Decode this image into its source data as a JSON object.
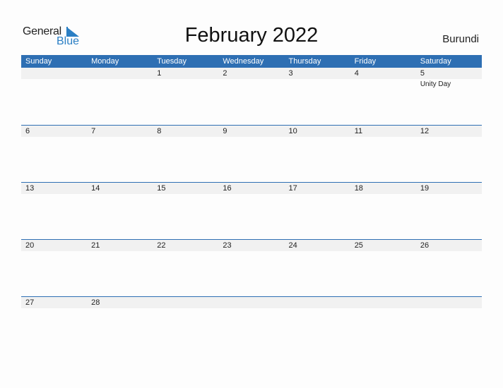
{
  "logo": {
    "line1": "General",
    "line2": "Blue"
  },
  "title": "February 2022",
  "country": "Burundi",
  "colors": {
    "accent": "#2e6fb3",
    "strip": "#f1f1f1"
  },
  "weekdays": [
    "Sunday",
    "Monday",
    "Tuesday",
    "Wednesday",
    "Thursday",
    "Friday",
    "Saturday"
  ],
  "weeks": [
    [
      {
        "day": ""
      },
      {
        "day": ""
      },
      {
        "day": "1"
      },
      {
        "day": "2"
      },
      {
        "day": "3"
      },
      {
        "day": "4"
      },
      {
        "day": "5",
        "holiday": "Unity Day"
      }
    ],
    [
      {
        "day": "6"
      },
      {
        "day": "7"
      },
      {
        "day": "8"
      },
      {
        "day": "9"
      },
      {
        "day": "10"
      },
      {
        "day": "11"
      },
      {
        "day": "12"
      }
    ],
    [
      {
        "day": "13"
      },
      {
        "day": "14"
      },
      {
        "day": "15"
      },
      {
        "day": "16"
      },
      {
        "day": "17"
      },
      {
        "day": "18"
      },
      {
        "day": "19"
      }
    ],
    [
      {
        "day": "20"
      },
      {
        "day": "21"
      },
      {
        "day": "22"
      },
      {
        "day": "23"
      },
      {
        "day": "24"
      },
      {
        "day": "25"
      },
      {
        "day": "26"
      }
    ],
    [
      {
        "day": "27"
      },
      {
        "day": "28"
      },
      {
        "day": ""
      },
      {
        "day": ""
      },
      {
        "day": ""
      },
      {
        "day": ""
      },
      {
        "day": ""
      }
    ]
  ]
}
